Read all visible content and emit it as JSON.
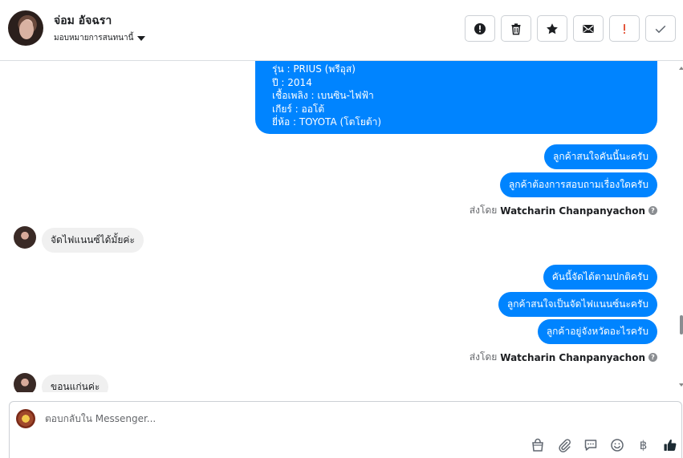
{
  "header": {
    "contact_name": "จ่อม อัจฉรา",
    "assign_label": "มอบหมายการสนทนานี้"
  },
  "actions": [
    {
      "name": "spam-button",
      "icon": "alert-circle-icon"
    },
    {
      "name": "delete-button",
      "icon": "trash-icon"
    },
    {
      "name": "star-button",
      "icon": "star-icon"
    },
    {
      "name": "mark-unread-button",
      "icon": "envelope-icon"
    },
    {
      "name": "follow-up-button",
      "icon": "exclamation-icon",
      "color": "#e4573d"
    },
    {
      "name": "mark-done-button",
      "icon": "check-icon"
    }
  ],
  "messages": {
    "car_info": [
      "รุ่น : PRIUS (พรีอุส)",
      "ปี : 2014",
      "เชื้อเพลิง : เบนซิน-ไฟฟ้า",
      "เกียร์ : ออโต้",
      "ยี่ห้อ : TOYOTA (โตโยต้า)"
    ],
    "out_group_1": [
      "ลูกค้าสนใจคันนี้นะครับ",
      "ลูกค้าต้องการสอบถามเรื่องใดครับ"
    ],
    "sent_by_label": "ส่งโดย",
    "sender_name": "Watcharin Chanpanyachon",
    "in_1": "จัดไฟแนนซ์ได้มั้ยค่ะ",
    "out_group_2": [
      "คันนี้จัดได้ตามปกติครับ",
      "ลูกค้าสนใจเป็นจัดไฟแนนซ์นะครับ",
      "ลูกค้าอยู่จังหวัดอะไรครับ"
    ],
    "in_2": "ขอนแก่นค่ะ"
  },
  "composer": {
    "placeholder": "ตอบกลับใน Messenger...",
    "tools": [
      "shop-bag-icon",
      "paperclip-icon",
      "saved-reply-icon",
      "emoji-icon",
      "baht-icon",
      "thumbs-up-icon"
    ],
    "baht_symbol": "฿"
  },
  "colors": {
    "bubble_out": "#0084ff",
    "bubble_in": "#f0f0f0",
    "thumb_up": "#1c2b33"
  }
}
